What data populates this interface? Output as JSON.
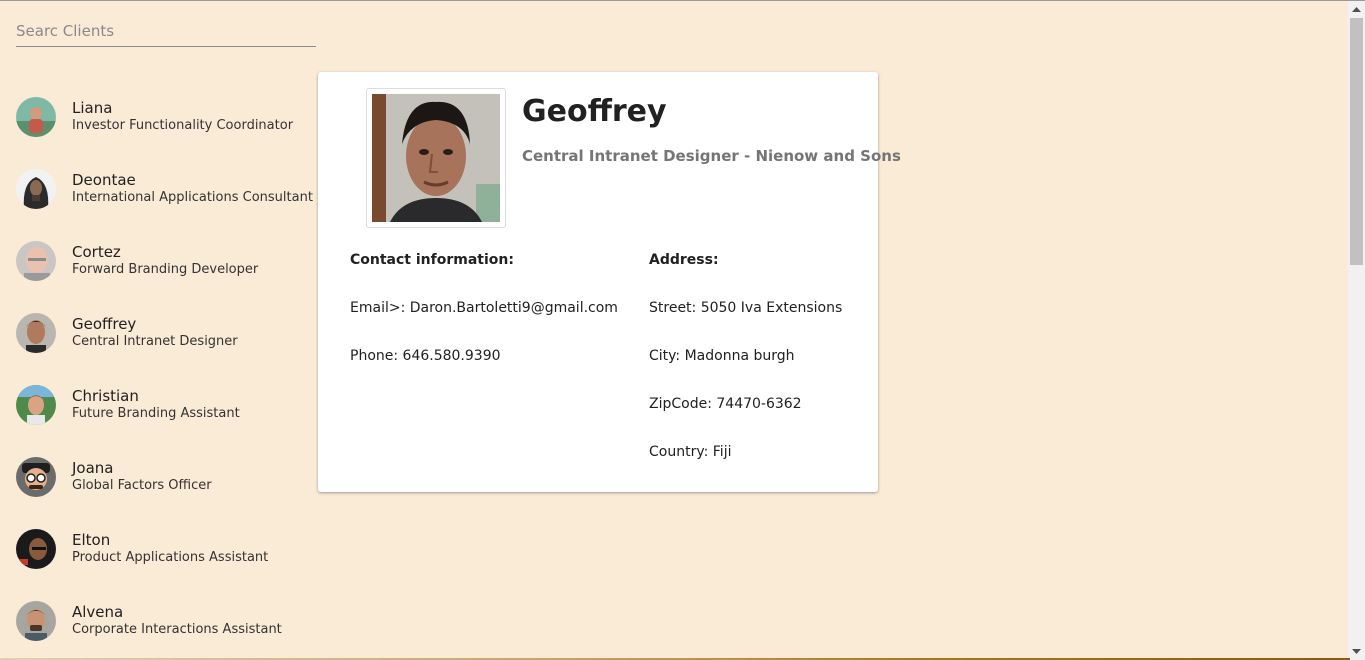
{
  "search": {
    "placeholder": "Searc Clients",
    "value": ""
  },
  "clients": [
    {
      "name": "Liana",
      "title": "Investor Functionality Coordinator",
      "avatar_icon": "person-photo-avatar"
    },
    {
      "name": "Deontae",
      "title": "International Applications Consultant",
      "avatar_icon": "person-photo-avatar"
    },
    {
      "name": "Cortez",
      "title": "Forward Branding Developer",
      "avatar_icon": "person-photo-avatar"
    },
    {
      "name": "Geoffrey",
      "title": "Central Intranet Designer",
      "avatar_icon": "person-photo-avatar"
    },
    {
      "name": "Christian",
      "title": "Future Branding Assistant",
      "avatar_icon": "person-photo-avatar"
    },
    {
      "name": "Joana",
      "title": "Global Factors Officer",
      "avatar_icon": "cartoon-avatar"
    },
    {
      "name": "Elton",
      "title": "Product Applications Assistant",
      "avatar_icon": "person-photo-avatar"
    },
    {
      "name": "Alvena",
      "title": "Corporate Interactions Assistant",
      "avatar_icon": "person-photo-avatar"
    }
  ],
  "detail": {
    "name": "Geoffrey",
    "subtitle": "Central Intranet Designer - Nienow and Sons",
    "contact": {
      "heading": "Contact information:",
      "email": "Email>: Daron.Bartoletti9@gmail.com",
      "phone": "Phone: 646.580.9390"
    },
    "address": {
      "heading": "Address:",
      "street": "Street: 5050 Iva Extensions",
      "city": "City: Madonna burgh",
      "zipcode": "ZipCode: 74470-6362",
      "country": "Country: Fiji"
    }
  },
  "colors": {
    "background": "#faebd7",
    "card": "#ffffff",
    "subtitle": "#757575"
  }
}
